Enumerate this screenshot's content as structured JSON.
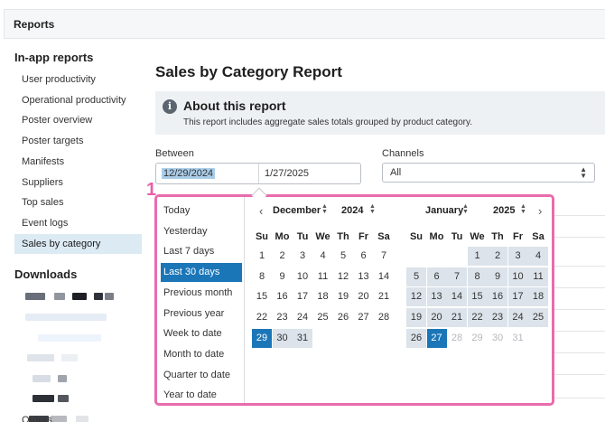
{
  "app": {
    "title": "Reports"
  },
  "sidebar": {
    "section_title": "In-app reports",
    "items": [
      {
        "label": "User productivity"
      },
      {
        "label": "Operational productivity"
      },
      {
        "label": "Poster overview"
      },
      {
        "label": "Poster targets"
      },
      {
        "label": "Manifests"
      },
      {
        "label": "Suppliers"
      },
      {
        "label": "Top sales"
      },
      {
        "label": "Event logs"
      },
      {
        "label": "Sales by category",
        "active": true
      }
    ],
    "downloads_title": "Downloads",
    "orders_label": "Orders"
  },
  "main": {
    "title": "Sales by Category Report",
    "about": {
      "heading": "About this report",
      "text": "This report includes aggregate sales totals grouped by product category.",
      "icon": "info-icon"
    },
    "between_label": "Between",
    "date_from": "12/29/2024",
    "date_to": "1/27/2025",
    "channels_label": "Channels",
    "channels_value": "All"
  },
  "callout": "1",
  "picker": {
    "presets": [
      {
        "label": "Today"
      },
      {
        "label": "Yesterday"
      },
      {
        "label": "Last 7 days"
      },
      {
        "label": "Last 30 days",
        "active": true
      },
      {
        "label": "Previous month"
      },
      {
        "label": "Previous year"
      },
      {
        "label": "Week to date"
      },
      {
        "label": "Month to date"
      },
      {
        "label": "Quarter to date"
      },
      {
        "label": "Year to date"
      }
    ],
    "weekdays": [
      "Su",
      "Mo",
      "Tu",
      "We",
      "Th",
      "Fr",
      "Sa"
    ],
    "left": {
      "month": "December",
      "year": "2024",
      "weeks": [
        [
          {
            "d": "1"
          },
          {
            "d": "2"
          },
          {
            "d": "3"
          },
          {
            "d": "4"
          },
          {
            "d": "5"
          },
          {
            "d": "6"
          },
          {
            "d": "7"
          }
        ],
        [
          {
            "d": "8"
          },
          {
            "d": "9"
          },
          {
            "d": "10"
          },
          {
            "d": "11"
          },
          {
            "d": "12"
          },
          {
            "d": "13"
          },
          {
            "d": "14"
          }
        ],
        [
          {
            "d": "15"
          },
          {
            "d": "16"
          },
          {
            "d": "17"
          },
          {
            "d": "18"
          },
          {
            "d": "19"
          },
          {
            "d": "20"
          },
          {
            "d": "21"
          }
        ],
        [
          {
            "d": "22"
          },
          {
            "d": "23"
          },
          {
            "d": "24"
          },
          {
            "d": "25"
          },
          {
            "d": "26"
          },
          {
            "d": "27"
          },
          {
            "d": "28"
          }
        ],
        [
          {
            "d": "29",
            "s": "sel"
          },
          {
            "d": "30",
            "s": "inrange"
          },
          {
            "d": "31",
            "s": "inrange"
          }
        ]
      ]
    },
    "right": {
      "month": "January",
      "year": "2025",
      "weeks": [
        [
          {
            "d": ""
          },
          {
            "d": ""
          },
          {
            "d": ""
          },
          {
            "d": "1",
            "s": "inrange"
          },
          {
            "d": "2",
            "s": "inrange"
          },
          {
            "d": "3",
            "s": "inrange"
          },
          {
            "d": "4",
            "s": "inrange"
          }
        ],
        [
          {
            "d": "5",
            "s": "inrange"
          },
          {
            "d": "6",
            "s": "inrange"
          },
          {
            "d": "7",
            "s": "inrange"
          },
          {
            "d": "8",
            "s": "inrange"
          },
          {
            "d": "9",
            "s": "inrange"
          },
          {
            "d": "10",
            "s": "inrange"
          },
          {
            "d": "11",
            "s": "inrange"
          }
        ],
        [
          {
            "d": "12",
            "s": "inrange"
          },
          {
            "d": "13",
            "s": "inrange"
          },
          {
            "d": "14",
            "s": "inrange"
          },
          {
            "d": "15",
            "s": "inrange"
          },
          {
            "d": "16",
            "s": "inrange"
          },
          {
            "d": "17",
            "s": "inrange"
          },
          {
            "d": "18",
            "s": "inrange"
          }
        ],
        [
          {
            "d": "19",
            "s": "inrange"
          },
          {
            "d": "20",
            "s": "inrange"
          },
          {
            "d": "21",
            "s": "inrange"
          },
          {
            "d": "22",
            "s": "inrange"
          },
          {
            "d": "23",
            "s": "inrange"
          },
          {
            "d": "24",
            "s": "inrange"
          },
          {
            "d": "25",
            "s": "inrange"
          }
        ],
        [
          {
            "d": "26",
            "s": "inrange"
          },
          {
            "d": "27",
            "s": "sel"
          },
          {
            "d": "28",
            "s": "dim"
          },
          {
            "d": "29",
            "s": "dim"
          },
          {
            "d": "30",
            "s": "dim"
          },
          {
            "d": "31",
            "s": "dim"
          }
        ]
      ]
    }
  },
  "colors": {
    "accent": "#1b76b8",
    "callout": "#e86cae",
    "range": "#dce3ea"
  }
}
